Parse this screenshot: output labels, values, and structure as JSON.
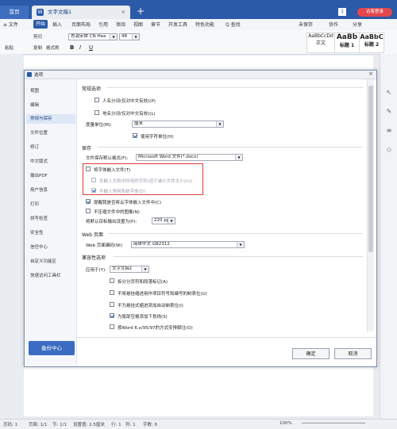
{
  "titlebar": {
    "home_tab": "首页",
    "doc_tab": "文字文稿1",
    "doc_tab_icon": "W",
    "login": "访客登录",
    "page_num": "1"
  },
  "menubar": {
    "file": "≡ 文件",
    "start": "开始",
    "items": [
      "插入",
      "页面布局",
      "引用",
      "审阅",
      "视图",
      "章节",
      "开发工具",
      "特色功能"
    ],
    "search": "Q 查找",
    "cloud": "未保存",
    "collab": "协作",
    "share": "分享"
  },
  "ribbon": {
    "paste": "粘贴",
    "cut": "剪切",
    "copy": "复制",
    "format_painter": "格式刷",
    "font_name": "思源宋体 CN Hea",
    "font_size": "48",
    "styles": [
      {
        "preview": "AaBbCcDd",
        "name": "正文"
      },
      {
        "preview": "AaBb",
        "name": "标题 1"
      },
      {
        "preview": "AaBbC",
        "name": "标题 2"
      }
    ]
  },
  "dialog": {
    "title": "选项",
    "nav": [
      "视图",
      "编辑",
      "常规与保存",
      "文件位置",
      "修订",
      "中文版式",
      "输出PDF",
      "用户信息",
      "打印",
      "拼写检查",
      "安全性",
      "信任中心",
      "自定义功能区",
      "快速访问工具栏"
    ],
    "backup": "备份中心",
    "general": {
      "header": "常规选项",
      "person": "人名分词(仅对中文有效)(P)",
      "place": "地名分词(仅对中文有效)(L)",
      "unit_label": "度量单位(M):",
      "unit_value": "厘米",
      "use_char_unit": "使用字符单位(H)"
    },
    "save": {
      "header": "保存",
      "format_label": "文件保存默认格式(F):",
      "format_value": "Microsoft Word 文件(*.docx)",
      "embed_font": "将字体嵌入文件(T)",
      "embed_used_only": "仅嵌入文档中所用的字符(适于减小文件大小)(U)",
      "no_common_fonts": "不嵌入常用系统字体(D)",
      "remind_cloud": "提醒我是否将云字体嵌入文件中(C)",
      "no_compress": "不压缩文件中的图像(N)",
      "default_output": "将默认目标输出设置为(P):",
      "ppi_value": "220 ppi"
    },
    "web": {
      "header": "Web 页面",
      "encoding_label": "Web 页面编码(W):",
      "encoding_value": "简体中文 GB2312"
    },
    "compat": {
      "header": "兼容性选项",
      "apply_label": "应用于(Y):",
      "apply_value": "文字文稿1",
      "options": [
        "拆分分页符和段落标记(A)",
        "不将悬挂缩进用作项目符号和编号的制表位(U)",
        "不为悬挂式缩进添加自动制表位(I)",
        "为尾部空格添加下划线(S)",
        "按Word 6.x/95/97的方式安排脚注(O)"
      ]
    },
    "ok": "确定",
    "cancel": "取消"
  },
  "statusbar": {
    "page": "页码: 1",
    "pages": "页面: 1/1",
    "section": "节: 1/1",
    "setting": "设置值: 2.5厘米",
    "row": "行: 1",
    "col": "列: 1",
    "words": "字数: 6",
    "zoom": "100%"
  }
}
